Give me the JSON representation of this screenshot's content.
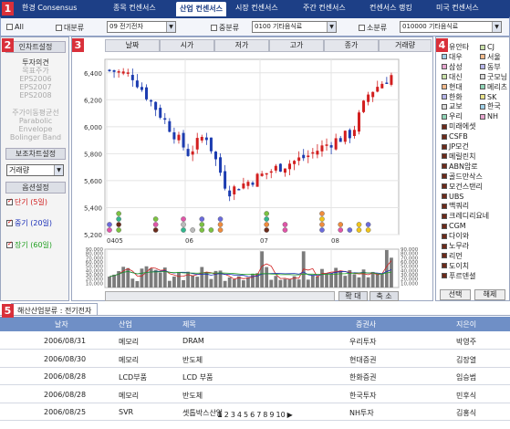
{
  "badges": [
    "1",
    "2",
    "3",
    "4",
    "5"
  ],
  "topnav": {
    "tabs": [
      "한경 Consensus",
      "종목 컨센서스",
      "산업 컨센서스",
      "시장 컨센서스",
      "주간 컨센서스",
      "컨센서스 랭킹",
      "미국 컨센서스"
    ],
    "active_index": 2
  },
  "filter": {
    "all_label": "All",
    "major_label": "대분류",
    "major_value": "09 전기전자",
    "mid_label": "중분류",
    "mid_value": "0100 기타음식료",
    "minor_label": "소분류",
    "minor_value": "010000 기타음식료"
  },
  "left": {
    "investor_head": "인차트설정",
    "investor_items": [
      "투자의견",
      "목표주가",
      "EPS2006",
      "EPS2007",
      "EPS2008"
    ],
    "ma_items": [
      "주가이동평균선",
      "Parabolic",
      "Envelope",
      "Bolinger Band"
    ],
    "aux_head": "보조차트설정",
    "aux_select": "거래량",
    "option_head": "옵션설정",
    "options": [
      {
        "label": "단기 (5일)",
        "color": "#d12020"
      },
      {
        "label": "중기 (20일)",
        "color": "#1a2fb8"
      },
      {
        "label": "장기 (60일)",
        "color": "#22a022"
      }
    ]
  },
  "chart": {
    "headers": [
      "날짜",
      "시가",
      "저가",
      "고가",
      "종가",
      "거래량"
    ],
    "y_labels": [
      "6,400",
      "6,200",
      "6,000",
      "5,800",
      "5,600",
      "5,400",
      "5,200"
    ],
    "x_labels": [
      "0405",
      "06",
      "07",
      "08"
    ],
    "vol_labels": [
      "90,000",
      "80,000",
      "70,000",
      "60,000",
      "50,000",
      "40,000",
      "30,000",
      "20,000",
      "10,000"
    ],
    "zoom_in": "확 대",
    "zoom_out": "축 소"
  },
  "chart_data": {
    "type": "candlestick",
    "price_range": [
      5200,
      6500
    ],
    "volume_range": [
      0,
      90000
    ],
    "x_ticks": [
      "0405",
      "06",
      "07",
      "08"
    ]
  },
  "right": {
    "brokers_left": [
      "유안타",
      "대우",
      "삼성",
      "대신",
      "현대",
      "한화",
      "교보",
      "우리",
      "미래에셋",
      "CSFB",
      "JP모건",
      "메릴린치",
      "ABN암로",
      "골드만삭스",
      "모건스탠리",
      "UBS",
      "맥쿼리",
      "크레디리요네",
      "CGM",
      "다이와",
      "노무라",
      "리먼",
      "도이치",
      "푸르덴셜"
    ],
    "brokers_right": [
      "CJ",
      "서울",
      "동부",
      "굿모닝",
      "메리츠",
      "SK",
      "한국",
      "NH"
    ],
    "select_label": "선택",
    "clear_label": "해제"
  },
  "bottom": {
    "tab_label": "해산산업분류 : 전기전자",
    "columns": [
      "날자",
      "산업",
      "제목",
      "증권사",
      "지은이"
    ],
    "rows": [
      [
        "2006/08/31",
        "메모리",
        "DRAM",
        "우리투자",
        "박영주"
      ],
      [
        "2006/08/30",
        "메모리",
        "반도체",
        "현대증권",
        "김장열"
      ],
      [
        "2006/08/28",
        "LCD부품",
        "LCD 부품",
        "한화증권",
        "임승범"
      ],
      [
        "2006/08/28",
        "메모리",
        "반도체",
        "한국투자",
        "민후식"
      ],
      [
        "2006/08/25",
        "SVR",
        "셋톱박스산업",
        "NH투자",
        "김홍식"
      ]
    ],
    "pages": [
      "1",
      "2",
      "3",
      "4",
      "5",
      "6",
      "7",
      "8",
      "9",
      "10",
      "▶"
    ]
  }
}
